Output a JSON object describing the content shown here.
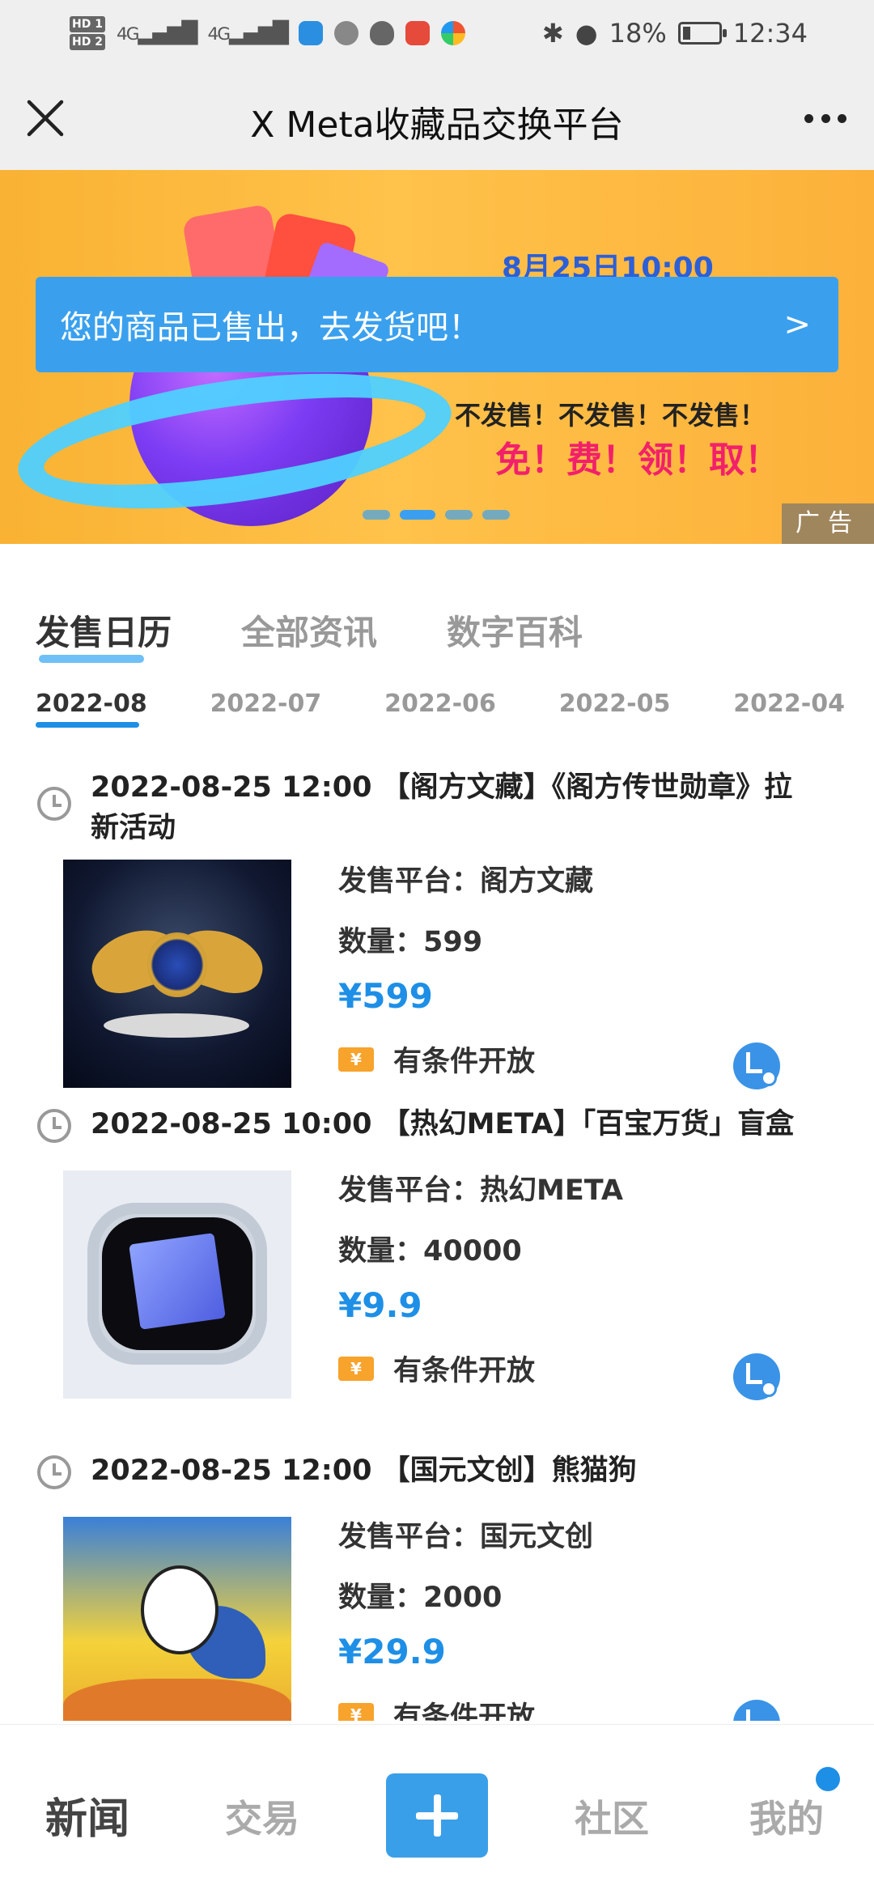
{
  "status_bar": {
    "hd1": "HD 1",
    "hd2": "HD 2",
    "signal1": "4G",
    "signal2": "4G",
    "battery_percent": "18%",
    "time": "12:34"
  },
  "header": {
    "title": "X Meta收藏品交换平台"
  },
  "banner": {
    "date_text": "8月25日10:00",
    "notice": "您的商品已售出，去发货吧！",
    "notice_arrow": ">",
    "line1": "不发售！不发售！不发售！",
    "line2": "免！费！领！取！",
    "ad_label": "广告",
    "slide_count": 4,
    "active_slide": 2
  },
  "category_tabs": [
    {
      "label": "发售日历",
      "active": true
    },
    {
      "label": "全部资讯",
      "active": false
    },
    {
      "label": "数字百科",
      "active": false
    }
  ],
  "month_tabs": [
    {
      "label": "2022-08",
      "active": true
    },
    {
      "label": "2022-07",
      "active": false
    },
    {
      "label": "2022-06",
      "active": false
    },
    {
      "label": "2022-05",
      "active": false
    },
    {
      "label": "2022-04",
      "active": false
    }
  ],
  "items": [
    {
      "title": "2022-08-25 12:00 【阁方文藏】《阁方传世勋章》拉新活动",
      "platform": "发售平台：阁方文藏",
      "quantity": "数量：599",
      "price": "¥599",
      "condition": "有条件开放"
    },
    {
      "title": "2022-08-25 10:00 【热幻META】「百宝万货」盲盒",
      "platform": "发售平台：热幻META",
      "quantity": "数量：40000",
      "price": "¥9.9",
      "condition": "有条件开放"
    },
    {
      "title": "2022-08-25 12:00 【国元文创】熊猫狗",
      "platform": "发售平台：国元文创",
      "quantity": "数量：2000",
      "price": "¥29.9",
      "condition": "有条件开放"
    }
  ],
  "bottom_nav": {
    "news": "新闻",
    "trade": "交易",
    "community": "社区",
    "mine": "我的"
  },
  "colors": {
    "accent": "#1e8fe6",
    "notice_bg": "#3aa0ee",
    "banner_bg": "#ffc24a",
    "promo_pink": "#f2206a"
  }
}
